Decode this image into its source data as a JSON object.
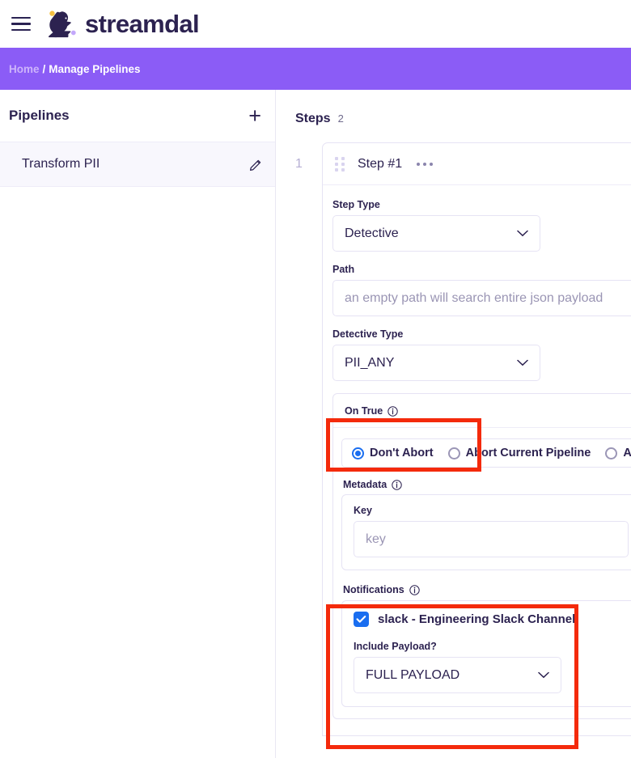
{
  "header": {
    "menu_icon": "hamburger-icon",
    "logo_icon": "streamdal-bird-logo",
    "brand": "streamdal"
  },
  "breadcrumb": {
    "home": "Home",
    "separator": "/",
    "current": "Manage Pipelines"
  },
  "sidebar": {
    "title": "Pipelines",
    "add_icon": "plus-icon",
    "items": [
      {
        "label": "Transform PII",
        "edit_icon": "pencil-icon",
        "selected": true
      }
    ]
  },
  "main": {
    "steps_title": "Steps",
    "steps_count": "2",
    "step": {
      "index": "1",
      "drag_icon": "drag-handle-icon",
      "name": "Step #1",
      "menu_icon": "ellipsis-icon",
      "step_type": {
        "label": "Step Type",
        "value": "Detective",
        "chevron_icon": "chevron-down-icon"
      },
      "path": {
        "label": "Path",
        "value": "",
        "placeholder": "an empty path will search entire json payload"
      },
      "detective_type": {
        "label": "Detective Type",
        "value": "PII_ANY",
        "chevron_icon": "chevron-down-icon"
      },
      "on_true": {
        "label": "On True",
        "info_icon": "info-icon",
        "abort_options": [
          {
            "label": "Don't Abort",
            "selected": true
          },
          {
            "label": "Abort Current Pipeline",
            "selected": false
          },
          {
            "label": "Abor",
            "selected": false
          }
        ],
        "metadata": {
          "label": "Metadata",
          "info_icon": "info-icon",
          "key_label": "Key",
          "key_value": "",
          "key_placeholder": "key"
        },
        "notifications": {
          "label": "Notifications",
          "info_icon": "info-icon",
          "channel_label": "slack - Engineering Slack Channel",
          "channel_checked": true,
          "include_payload_label": "Include Payload?",
          "include_payload_value": "FULL PAYLOAD",
          "chevron_icon": "chevron-down-icon"
        }
      }
    }
  },
  "annotations": [
    {
      "name": "on-true-highlight",
      "color": "#f42a0c"
    },
    {
      "name": "notifications-highlight",
      "color": "#f42a0c"
    }
  ],
  "colors": {
    "brand_purple": "#8b5cf6",
    "brand_navy": "#2c2250",
    "accent_blue": "#1a6ef0",
    "annotation_red": "#f42a0c",
    "selected_row": "#f8f7fd"
  }
}
